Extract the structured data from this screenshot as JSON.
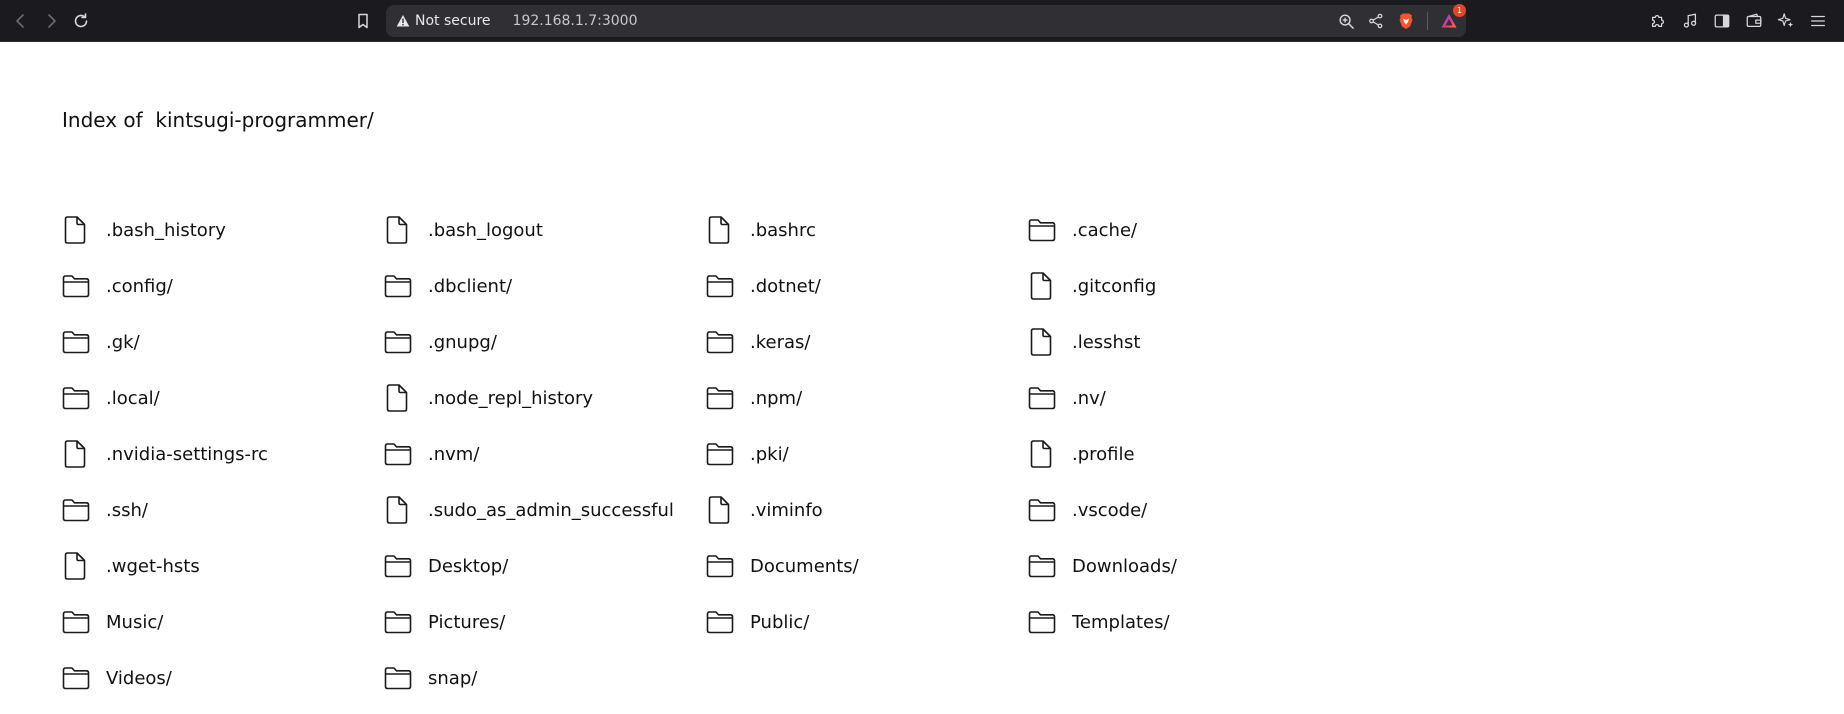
{
  "browser": {
    "security_label": "Not secure",
    "url": "192.168.1.7:3000",
    "notification_count": "1",
    "icons": {
      "back": "chevron-left-icon",
      "forward": "chevron-right-icon",
      "reload": "reload-icon",
      "bookmark": "bookmark-icon",
      "warning": "warning-triangle-icon",
      "zoom": "zoom-in-icon",
      "share": "share-icon",
      "brave_shields": "brave-shield-icon",
      "brave_rewards": "rewards-triangle-icon",
      "extensions": "puzzle-icon",
      "media": "music-note-icon",
      "sidebar": "sidebar-icon",
      "wallet": "wallet-icon",
      "leo": "sparkle-icon",
      "menu": "hamburger-menu-icon"
    },
    "colors": {
      "toolbar_bg": "#1b1b1f",
      "urlbar_bg": "#303034",
      "brave_orange": "#fb542b",
      "badge_red": "#e2452c"
    }
  },
  "page": {
    "title": "Index of  kintsugi-programmer/",
    "entries": [
      {
        "name": ".bash_history",
        "type": "file"
      },
      {
        "name": ".bash_logout",
        "type": "file"
      },
      {
        "name": ".bashrc",
        "type": "file"
      },
      {
        "name": ".cache/",
        "type": "folder"
      },
      {
        "name": ".config/",
        "type": "folder"
      },
      {
        "name": ".dbclient/",
        "type": "folder"
      },
      {
        "name": ".dotnet/",
        "type": "folder"
      },
      {
        "name": ".gitconfig",
        "type": "file"
      },
      {
        "name": ".gk/",
        "type": "folder"
      },
      {
        "name": ".gnupg/",
        "type": "folder"
      },
      {
        "name": ".keras/",
        "type": "folder"
      },
      {
        "name": ".lesshst",
        "type": "file"
      },
      {
        "name": ".local/",
        "type": "folder"
      },
      {
        "name": ".node_repl_history",
        "type": "file"
      },
      {
        "name": ".npm/",
        "type": "folder"
      },
      {
        "name": ".nv/",
        "type": "folder"
      },
      {
        "name": ".nvidia-settings-rc",
        "type": "file"
      },
      {
        "name": ".nvm/",
        "type": "folder"
      },
      {
        "name": ".pki/",
        "type": "folder"
      },
      {
        "name": ".profile",
        "type": "file"
      },
      {
        "name": ".ssh/",
        "type": "folder"
      },
      {
        "name": ".sudo_as_admin_successful",
        "type": "file"
      },
      {
        "name": ".viminfo",
        "type": "file"
      },
      {
        "name": ".vscode/",
        "type": "folder"
      },
      {
        "name": ".wget-hsts",
        "type": "file"
      },
      {
        "name": "Desktop/",
        "type": "folder"
      },
      {
        "name": "Documents/",
        "type": "folder"
      },
      {
        "name": "Downloads/",
        "type": "folder"
      },
      {
        "name": "Music/",
        "type": "folder"
      },
      {
        "name": "Pictures/",
        "type": "folder"
      },
      {
        "name": "Public/",
        "type": "folder"
      },
      {
        "name": "Templates/",
        "type": "folder"
      },
      {
        "name": "Videos/",
        "type": "folder"
      },
      {
        "name": "snap/",
        "type": "folder"
      }
    ]
  }
}
